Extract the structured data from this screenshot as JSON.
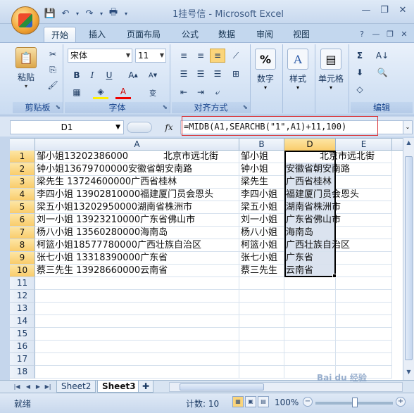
{
  "window": {
    "title": "1挂号信 - Microsoft Excel"
  },
  "qat": {
    "icons": [
      "save-icon",
      "undo-icon",
      "redo-icon",
      "print-icon"
    ]
  },
  "tabs": [
    "开始",
    "插入",
    "页面布局",
    "公式",
    "数据",
    "审阅",
    "视图"
  ],
  "ribbon": {
    "clipboard": {
      "label": "剪贴板",
      "paste": "粘贴"
    },
    "font": {
      "label": "字体",
      "name": "宋体",
      "size": "11",
      "bold": "B",
      "italic": "I",
      "underline": "U",
      "font_color_glyph": "A"
    },
    "align": {
      "label": "对齐方式"
    },
    "number": {
      "label": "数字",
      "button": "数字",
      "glyph": "%"
    },
    "styles": {
      "button": "样式",
      "glyph": "A"
    },
    "cells": {
      "button": "单元格"
    },
    "editing": {
      "label": "编辑",
      "sigma": "Σ"
    }
  },
  "formula_bar": {
    "name_box": "D1",
    "fx": "fx",
    "formula": "=MIDB(A1,SEARCHB(\"1\",A1)+11,100)"
  },
  "grid": {
    "columns": [
      "A",
      "B",
      "D",
      "E"
    ],
    "selected_column": "D",
    "rows": [
      {
        "num": "1",
        "a": "邹小姐13202386000",
        "a2": "北京市远北街",
        "b": "邹小姐",
        "d": "",
        "d_overflow": "北京市远北街"
      },
      {
        "num": "2",
        "a": "钟小姐13679700000安徽省朝安南路",
        "a2": "",
        "b": "钟小姐",
        "d": "安徽省朝安南路",
        "d_overflow": ""
      },
      {
        "num": "3",
        "a": "梁先生 13724600000广西省桂林",
        "a2": "",
        "b": "梁先生",
        "d": "广西省桂林",
        "d_overflow": ""
      },
      {
        "num": "4",
        "a": "李四小姐 13902810000福建厦门员会恩头",
        "a2": "",
        "b": "李四小姐",
        "d": "福建厦门员会恩头",
        "d_overflow": ""
      },
      {
        "num": "5",
        "a": "梁五小姐13202950000湖南省株洲市",
        "a2": "",
        "b": "梁五小姐",
        "d": "湖南省株洲市",
        "d_overflow": ""
      },
      {
        "num": "6",
        "a": "刘一小姐 13923210000广东省佛山市",
        "a2": "",
        "b": "刘一小姐",
        "d": "广东省佛山市",
        "d_overflow": ""
      },
      {
        "num": "7",
        "a": "杨八小姐 13560280000海南岛",
        "a2": "",
        "b": "杨八小姐",
        "d": "海南岛",
        "d_overflow": ""
      },
      {
        "num": "8",
        "a": "柯篮小姐18577780000广西壮族自治区",
        "a2": "",
        "b": "柯篮小姐",
        "d": "广西壮族自治区",
        "d_overflow": ""
      },
      {
        "num": "9",
        "a": "张七小姐 13318390000广东省",
        "a2": "",
        "b": "张七小姐",
        "d": "广东省",
        "d_overflow": ""
      },
      {
        "num": "10",
        "a": "蔡三先生 13928660000云南省",
        "a2": "",
        "b": "蔡三先生",
        "d": "云南省",
        "d_overflow": ""
      },
      {
        "num": "11"
      },
      {
        "num": "12"
      },
      {
        "num": "13"
      },
      {
        "num": "14"
      },
      {
        "num": "15"
      },
      {
        "num": "16"
      },
      {
        "num": "17"
      },
      {
        "num": "18"
      }
    ]
  },
  "sheets": [
    "Sheet2",
    "Sheet3"
  ],
  "active_sheet": "Sheet3",
  "status": {
    "mode": "就绪",
    "count": "计数: 10",
    "zoom": "100%"
  }
}
